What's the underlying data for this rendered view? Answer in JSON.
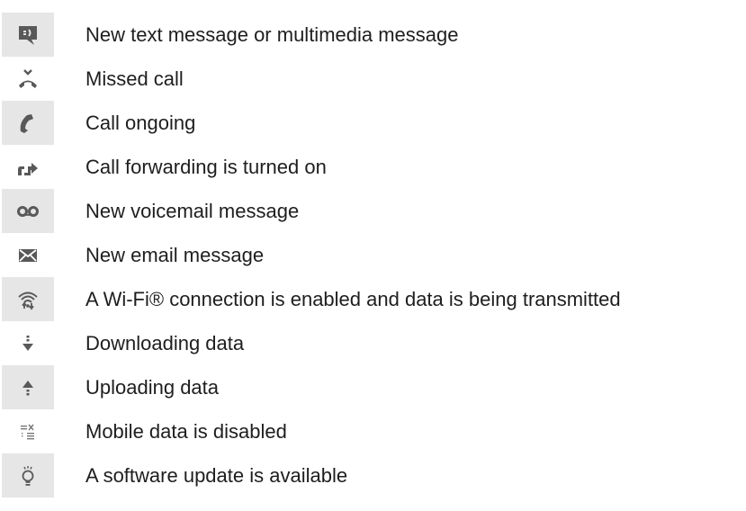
{
  "rows": [
    {
      "icon": "new-message-icon",
      "text": "New text message or multimedia message",
      "shaded": true
    },
    {
      "icon": "missed-call-icon",
      "text": "Missed call",
      "shaded": false
    },
    {
      "icon": "call-ongoing-icon",
      "text": "Call ongoing",
      "shaded": true
    },
    {
      "icon": "call-forwarding-icon",
      "text": "Call forwarding is turned on",
      "shaded": false
    },
    {
      "icon": "voicemail-icon",
      "text": "New voicemail message",
      "shaded": true
    },
    {
      "icon": "email-icon",
      "text": "New email message",
      "shaded": false
    },
    {
      "icon": "wifi-transmitting-icon",
      "text": "A Wi-Fi® connection is enabled and data is being transmitted",
      "shaded": true
    },
    {
      "icon": "download-icon",
      "text": "Downloading data",
      "shaded": false
    },
    {
      "icon": "upload-icon",
      "text": "Uploading data",
      "shaded": true
    },
    {
      "icon": "mobile-data-disabled-icon",
      "text": "Mobile data is disabled",
      "shaded": false
    },
    {
      "icon": "software-update-icon",
      "text": "A software update is available",
      "shaded": true
    }
  ]
}
